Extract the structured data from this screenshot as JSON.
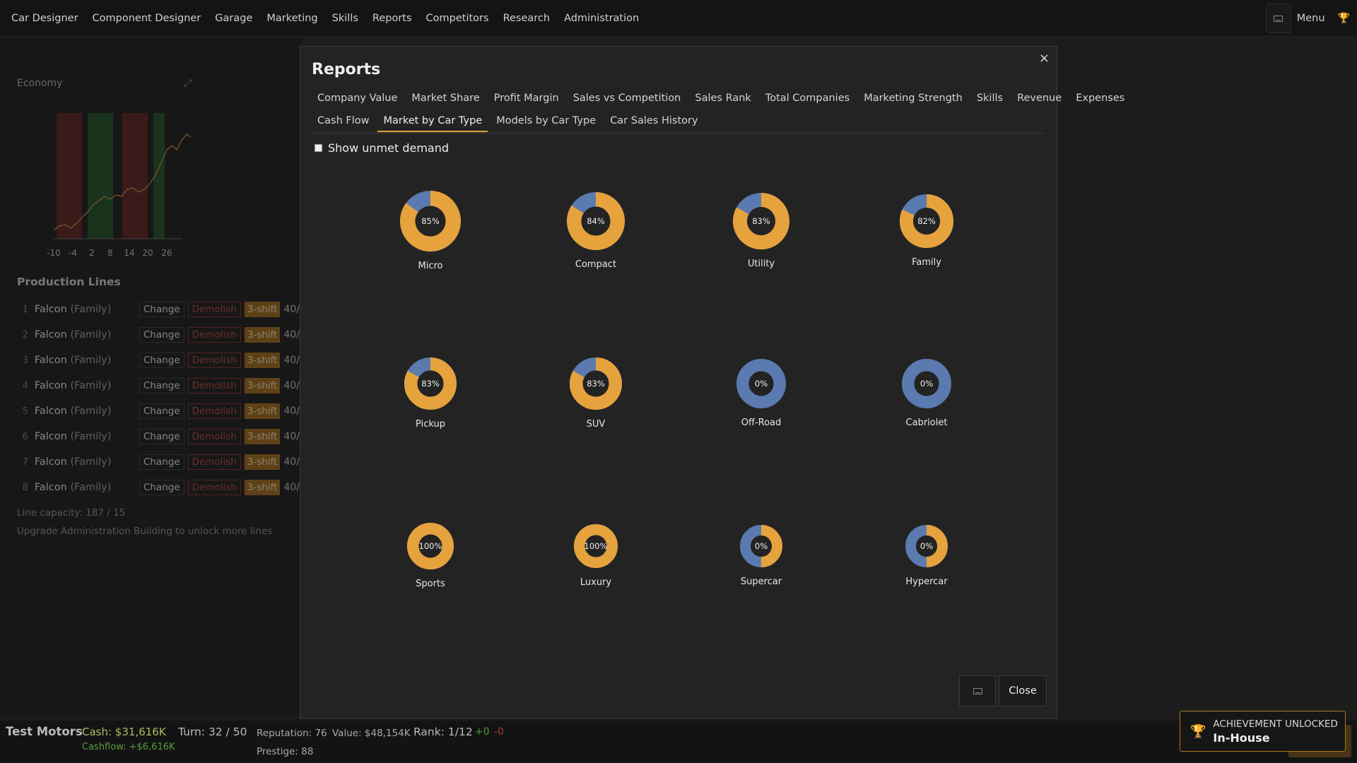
{
  "nav": {
    "items": [
      "Car Designer",
      "Component Designer",
      "Garage",
      "Marketing",
      "Skills",
      "Reports",
      "Competitors",
      "Research",
      "Administration"
    ],
    "menu_label": "Menu",
    "trophy_icon": "trophy-icon",
    "keyboard_icon": "keyboard-icon"
  },
  "background": {
    "economy_title": "Economy",
    "economy_x_ticks": [
      "-10",
      "-4",
      "2",
      "8",
      "14",
      "20",
      "26"
    ],
    "production_title": "Production Lines",
    "lines": [
      {
        "num": "1",
        "name": "Falcon",
        "type": "(Family)",
        "change": "Change",
        "demolish": "Demolish",
        "shift": "3-shift",
        "cap": "40/"
      },
      {
        "num": "2",
        "name": "Falcon",
        "type": "(Family)",
        "change": "Change",
        "demolish": "Demolish",
        "shift": "3-shift",
        "cap": "40/"
      },
      {
        "num": "3",
        "name": "Falcon",
        "type": "(Family)",
        "change": "Change",
        "demolish": "Demolish",
        "shift": "3-shift",
        "cap": "40/"
      },
      {
        "num": "4",
        "name": "Falcon",
        "type": "(Family)",
        "change": "Change",
        "demolish": "Demolish",
        "shift": "3-shift",
        "cap": "40/"
      },
      {
        "num": "5",
        "name": "Falcon",
        "type": "(Family)",
        "change": "Change",
        "demolish": "Demolish",
        "shift": "3-shift",
        "cap": "40/"
      },
      {
        "num": "6",
        "name": "Falcon",
        "type": "(Family)",
        "change": "Change",
        "demolish": "Demolish",
        "shift": "3-shift",
        "cap": "40/"
      },
      {
        "num": "7",
        "name": "Falcon",
        "type": "(Family)",
        "change": "Change",
        "demolish": "Demolish",
        "shift": "3-shift",
        "cap": "40/"
      },
      {
        "num": "8",
        "name": "Falcon",
        "type": "(Family)",
        "change": "Change",
        "demolish": "Demolish",
        "shift": "3-shift",
        "cap": "40/"
      }
    ],
    "line_capacity": "Line capacity: 187 / 15",
    "upgrade_note": "Upgrade Administration Building to unlock more lines"
  },
  "modal": {
    "title": "Reports",
    "close_x": "×",
    "tabs_row1": [
      "Company Value",
      "Market Share",
      "Profit Margin",
      "Sales vs Competition",
      "Sales Rank",
      "Total Companies",
      "Marketing Strength",
      "Skills",
      "Revenue",
      "Expenses"
    ],
    "tabs_row2": [
      "Cash Flow",
      "Market by Car Type",
      "Models by Car Type",
      "Car Sales History"
    ],
    "active_tab": "Market by Car Type",
    "unmet_label": "Show unmet demand",
    "unmet_checked": false,
    "close_button": "Close",
    "colors": {
      "share": "#e6a23c",
      "other": "#5a7ab0",
      "hole": "#232323"
    },
    "chart_data": {
      "type": "pie",
      "series_note": "",
      "categories": [
        "Micro",
        "Compact",
        "Utility",
        "Family",
        "Pickup",
        "SUV",
        "Off-Road",
        "Cabriolet",
        "Sports",
        "Luxury",
        "Supercar",
        "Hypercar"
      ],
      "values": [
        85,
        84,
        83,
        82,
        83,
        83,
        0,
        0,
        100,
        100,
        0,
        0
      ],
      "labels": [
        "85%",
        "84%",
        "83%",
        "82%",
        "83%",
        "83%",
        "0%",
        "0%",
        "100%",
        "100%",
        "0%",
        "0%"
      ],
      "ring_orange_fraction": [
        0.85,
        0.84,
        0.83,
        0.82,
        0.83,
        0.83,
        0.0,
        0.0,
        1.0,
        1.0,
        0.5,
        0.5
      ]
    }
  },
  "status": {
    "company": "Test Motors",
    "cash": "Cash: $31,616K",
    "cashflow": "Cashflow: +$6,616K",
    "turn": "Turn: 32 / 50",
    "reputation": "Reputation: 76",
    "prestige": "Prestige: 88",
    "value": "Value: $48,154K",
    "rank": "Rank: 1/12",
    "rank_plus": "+0",
    "rank_minus": "-0"
  },
  "achievement": {
    "top": "ACHIEVEMENT UNLOCKED",
    "name": "In-House",
    "icon": "trophy-icon"
  }
}
